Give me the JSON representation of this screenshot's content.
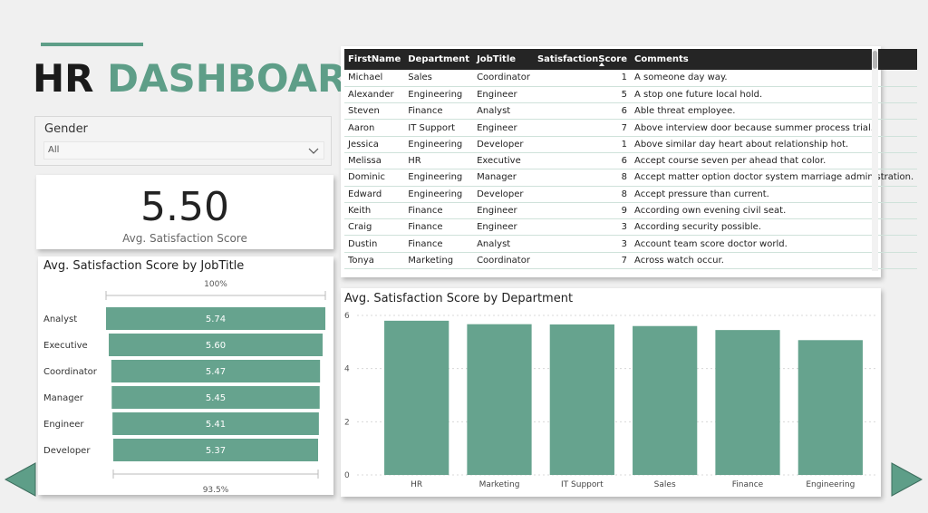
{
  "header": {
    "title_part1": "HR",
    "title_part2": "DASHBOARDS"
  },
  "colors": {
    "accent": "#5e9e88",
    "bar": "#66a38e",
    "header_bg": "#252525"
  },
  "slicer": {
    "label": "Gender",
    "value": "All"
  },
  "kpi": {
    "value": "5.50",
    "label": "Avg. Satisfaction Score"
  },
  "table": {
    "columns": [
      "FirstName",
      "Department",
      "JobTitle",
      "SatisfactionScore",
      "Comments"
    ],
    "rows": [
      [
        "Michael",
        "Sales",
        "Coordinator",
        "1",
        "A someone day way."
      ],
      [
        "Alexander",
        "Engineering",
        "Engineer",
        "5",
        "A stop one future local hold."
      ],
      [
        "Steven",
        "Finance",
        "Analyst",
        "6",
        "Able threat employee."
      ],
      [
        "Aaron",
        "IT Support",
        "Engineer",
        "7",
        "Above interview door because summer process trial."
      ],
      [
        "Jessica",
        "Engineering",
        "Developer",
        "1",
        "Above similar day heart about relationship hot."
      ],
      [
        "Melissa",
        "HR",
        "Executive",
        "6",
        "Accept course seven per ahead that color."
      ],
      [
        "Dominic",
        "Engineering",
        "Manager",
        "8",
        "Accept matter option doctor system marriage administration."
      ],
      [
        "Edward",
        "Engineering",
        "Developer",
        "8",
        "Accept pressure than current."
      ],
      [
        "Keith",
        "Finance",
        "Engineer",
        "9",
        "According own evening civil seat."
      ],
      [
        "Craig",
        "Finance",
        "Engineer",
        "3",
        "According security possible."
      ],
      [
        "Dustin",
        "Finance",
        "Analyst",
        "3",
        "Account team score doctor world."
      ],
      [
        "Tonya",
        "Marketing",
        "Coordinator",
        "7",
        "Across watch occur."
      ]
    ]
  },
  "chart_data": [
    {
      "type": "bar",
      "orientation": "funnel",
      "title": "Avg. Satisfaction Score by JobTitle",
      "categories": [
        "Analyst",
        "Executive",
        "Coordinator",
        "Manager",
        "Engineer",
        "Developer"
      ],
      "values": [
        5.74,
        5.6,
        5.47,
        5.45,
        5.41,
        5.37
      ],
      "labels": [
        "5.74",
        "5.60",
        "5.47",
        "5.45",
        "5.41",
        "5.37"
      ],
      "top_label": "100%",
      "bottom_label": "93.5%"
    },
    {
      "type": "bar",
      "title": "Avg. Satisfaction Score by Department",
      "categories": [
        "HR",
        "Marketing",
        "IT Support",
        "Sales",
        "Finance",
        "Engineering"
      ],
      "values": [
        5.8,
        5.67,
        5.66,
        5.6,
        5.45,
        5.07
      ],
      "ylim": [
        0,
        6
      ],
      "yticks": [
        "0",
        "2",
        "4",
        "6"
      ],
      "grid": true
    }
  ],
  "nav": {
    "prev_icon": "triangle-left-icon",
    "next_icon": "triangle-right-icon"
  }
}
